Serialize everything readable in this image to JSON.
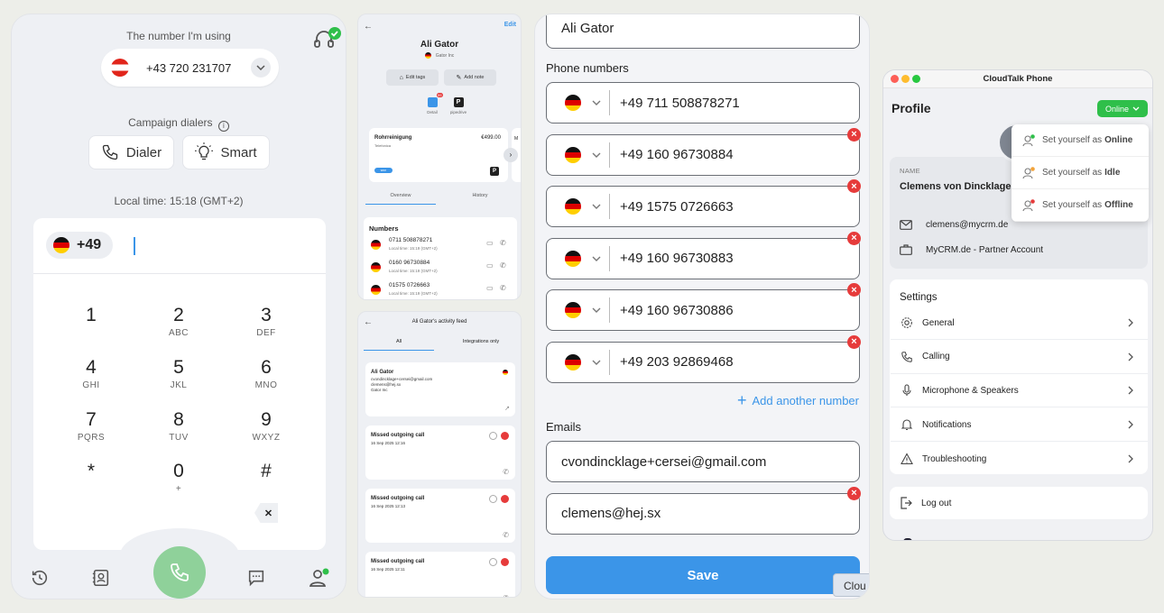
{
  "dialer": {
    "header_label": "The number I'm using",
    "selected_number": "+43 720 231707",
    "campaign_label": "Campaign dialers",
    "btn_dialer": "Dialer",
    "btn_smart": "Smart",
    "local_time": "Local time: 15:18 (GMT+2)",
    "prefix": "+49",
    "keys": [
      {
        "d": "1",
        "l": ""
      },
      {
        "d": "2",
        "l": "ABC"
      },
      {
        "d": "3",
        "l": "DEF"
      },
      {
        "d": "4",
        "l": "GHI"
      },
      {
        "d": "5",
        "l": "JKL"
      },
      {
        "d": "6",
        "l": "MNO"
      },
      {
        "d": "7",
        "l": "PQRS"
      },
      {
        "d": "8",
        "l": "TUV"
      },
      {
        "d": "9",
        "l": "WXYZ"
      },
      {
        "d": "*",
        "l": ""
      },
      {
        "d": "0",
        "l": "+"
      },
      {
        "d": "#",
        "l": ""
      }
    ],
    "backspace": "✕"
  },
  "contact": {
    "edit": "Edit",
    "name": "Ali Gator",
    "company": "Gator Inc",
    "edit_tags": "Edit tags",
    "add_note": "Add note",
    "badge_count": "99",
    "detail_label": "Detail",
    "pipedrive_label": "pipedrive",
    "deal_title": "Rohrreinigung",
    "deal_sub": "Telefonica",
    "deal_amount": "€499.00",
    "deal_tag": "won",
    "deal_partial": "M",
    "tab_overview": "Overview",
    "tab_history": "History",
    "numbers_title": "Numbers",
    "numbers": [
      {
        "num": "0711 508878271",
        "time": "Local time: 15:19 (GMT+2)"
      },
      {
        "num": "0160 96730884",
        "time": "Local time: 15:19 (GMT+2)"
      },
      {
        "num": "01575 0726663",
        "time": "Local time: 15:19 (GMT+2)"
      }
    ]
  },
  "feed": {
    "title": "Ali Gator's activity feed",
    "tab_all": "All",
    "tab_integrations": "Integrations only",
    "contact_name": "Ali Gator",
    "contact_lines": [
      "cvondincklage+cersei@gmail.com",
      "clemens@hej.sx",
      "Gator Inc"
    ],
    "calls": [
      {
        "title": "Missed outgoing call",
        "date": "16 Sep 2025 12:16"
      },
      {
        "title": "Missed outgoing call",
        "date": "16 Sep 2025 12:13"
      },
      {
        "title": "Missed outgoing call",
        "date": "16 Sep 2025 12:11"
      }
    ]
  },
  "form": {
    "name_value": "Ali Gator",
    "phone_label": "Phone numbers",
    "phones": [
      "+49 711 508878271",
      "+49 160 96730884",
      "+49 1575 0726663",
      "+49 160 96730883",
      "+49 160 96730886",
      "+49 203 92869468"
    ],
    "add_number": "Add another number",
    "emails_label": "Emails",
    "emails": [
      "cvondincklage+cersei@gmail.com",
      "clemens@hej.sx"
    ],
    "save": "Save",
    "tooltip": "Clou"
  },
  "profile": {
    "window_title": "CloudTalk Phone",
    "heading": "Profile",
    "status": "Online",
    "name_label": "NAME",
    "name": "Clemens von Dincklage",
    "email": "clemens@mycrm.de",
    "account": "MyCRM.de - Partner Account",
    "status_menu": [
      {
        "prefix": "Set yourself as",
        "status": "Online",
        "color": "#2fbf4a"
      },
      {
        "prefix": "Set yourself as",
        "status": "Idle",
        "color": "#f2a33a"
      },
      {
        "prefix": "Set yourself as",
        "status": "Offline",
        "color": "#e63b3b"
      }
    ],
    "settings_title": "Settings",
    "settings": [
      "General",
      "Calling",
      "Microphone & Speakers",
      "Notifications",
      "Troubleshooting"
    ],
    "logout": "Log out"
  },
  "colors": {
    "accent": "#3b95e8",
    "online": "#2fbf4a",
    "danger": "#e63b3b",
    "call": "#8fd19a"
  }
}
